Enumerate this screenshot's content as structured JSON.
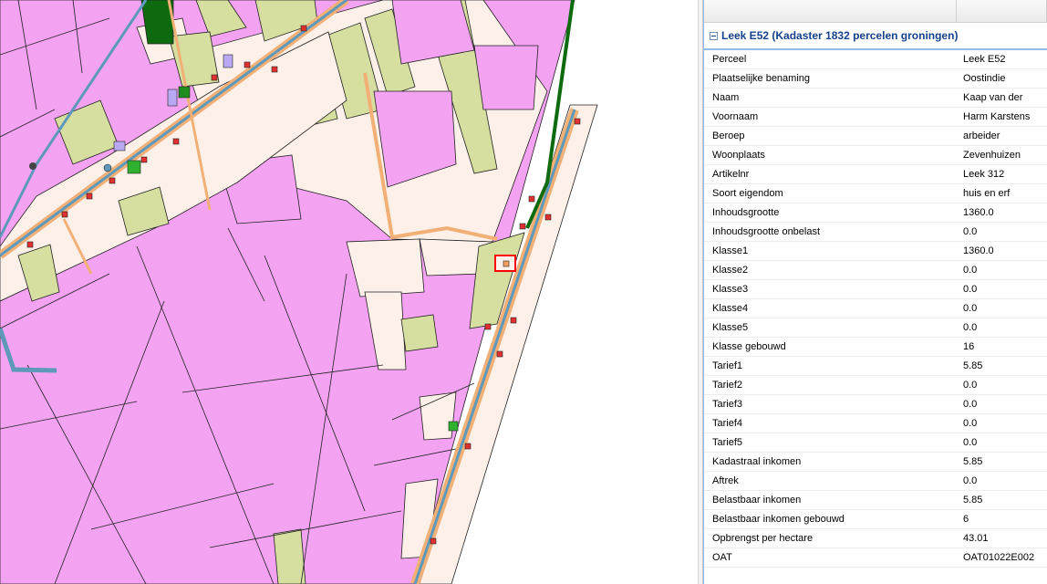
{
  "map": {
    "colors": {
      "pink": "#f3a3f1",
      "cream": "#fcf0e9",
      "olive": "#d6dea0",
      "dark_green": "#0e6a0e",
      "green": "#2fb12f",
      "road_orange": "#f2b076",
      "canal_blue": "#5e98bb",
      "selection_red": "#ff0000"
    }
  },
  "panel": {
    "group_title": "Leek E52 (Kadaster 1832 percelen groningen)",
    "properties": [
      {
        "name": "Perceel",
        "value": "Leek E52"
      },
      {
        "name": "Plaatselijke benaming",
        "value": "Oostindie"
      },
      {
        "name": "Naam",
        "value": "Kaap van der"
      },
      {
        "name": "Voornaam",
        "value": "Harm Karstens"
      },
      {
        "name": "Beroep",
        "value": "arbeider"
      },
      {
        "name": "Woonplaats",
        "value": "Zevenhuizen"
      },
      {
        "name": "Artikelnr",
        "value": "Leek 312"
      },
      {
        "name": "Soort eigendom",
        "value": "huis en erf"
      },
      {
        "name": "Inhoudsgrootte",
        "value": "1360.0"
      },
      {
        "name": "Inhoudsgrootte onbelast",
        "value": "0.0"
      },
      {
        "name": "Klasse1",
        "value": "1360.0"
      },
      {
        "name": "Klasse2",
        "value": "0.0"
      },
      {
        "name": "Klasse3",
        "value": "0.0"
      },
      {
        "name": "Klasse4",
        "value": "0.0"
      },
      {
        "name": "Klasse5",
        "value": "0.0"
      },
      {
        "name": "Klasse gebouwd",
        "value": "16"
      },
      {
        "name": "Tarief1",
        "value": "5.85"
      },
      {
        "name": "Tarief2",
        "value": "0.0"
      },
      {
        "name": "Tarief3",
        "value": "0.0"
      },
      {
        "name": "Tarief4",
        "value": "0.0"
      },
      {
        "name": "Tarief5",
        "value": "0.0"
      },
      {
        "name": "Kadastraal inkomen",
        "value": "5.85"
      },
      {
        "name": "Aftrek",
        "value": "0.0"
      },
      {
        "name": "Belastbaar inkomen",
        "value": "5.85"
      },
      {
        "name": "Belastbaar inkomen gebouwd",
        "value": "6"
      },
      {
        "name": "Opbrengst per hectare",
        "value": "43.01"
      },
      {
        "name": "OAT",
        "value": "OAT01022E002"
      }
    ]
  }
}
